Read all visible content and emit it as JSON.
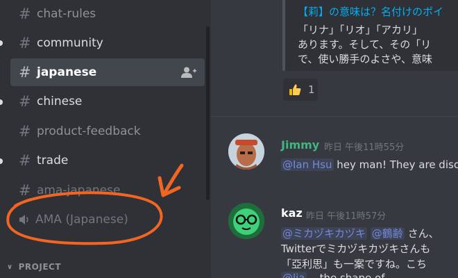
{
  "sidebar": {
    "channels": [
      {
        "name": "chat-rules"
      },
      {
        "name": "community"
      },
      {
        "name": "japanese"
      },
      {
        "name": "chinese"
      },
      {
        "name": "product-feedback"
      },
      {
        "name": "trade"
      },
      {
        "name": "ama-japanese"
      }
    ],
    "voice_channel": {
      "name": "AMA (Japanese)"
    },
    "category": {
      "label": "PROJECT"
    }
  },
  "chat": {
    "embed": {
      "title": "【莉】の意味は？名付けのポイ",
      "lines": [
        "「リナ」「リオ」「アカリ」",
        "あります。そして、その「リ",
        "で、使い勝手のよさや、意味"
      ]
    },
    "reaction": {
      "emoji": "👍",
      "count": "1"
    },
    "messages": [
      {
        "author": "Jimmy",
        "author_color": "#43b581",
        "timestamp": "昨日 午後11時55分",
        "mention": "@Ian Hsu",
        "text": " hey man! They are disc"
      },
      {
        "author": "kaz",
        "author_color": "#ffffff",
        "timestamp": "昨日 午後11時57分",
        "mention1": "@ミカヅキカヅキ",
        "mention2": "@鶴齢",
        "line1_rest": " さん、",
        "line2": "Twitterでミカヅキカヅキさんも",
        "line3": "「亞利思」も一案ですね。こち",
        "line4_mention": "@lia",
        "line4_rest": " ...the shape of..."
      }
    ]
  },
  "colors": {
    "sidebar_bg": "#2f3136",
    "chat_bg": "#36393f",
    "link": "#00b0f4",
    "mention": "#7289da",
    "annotation": "#f26522"
  }
}
